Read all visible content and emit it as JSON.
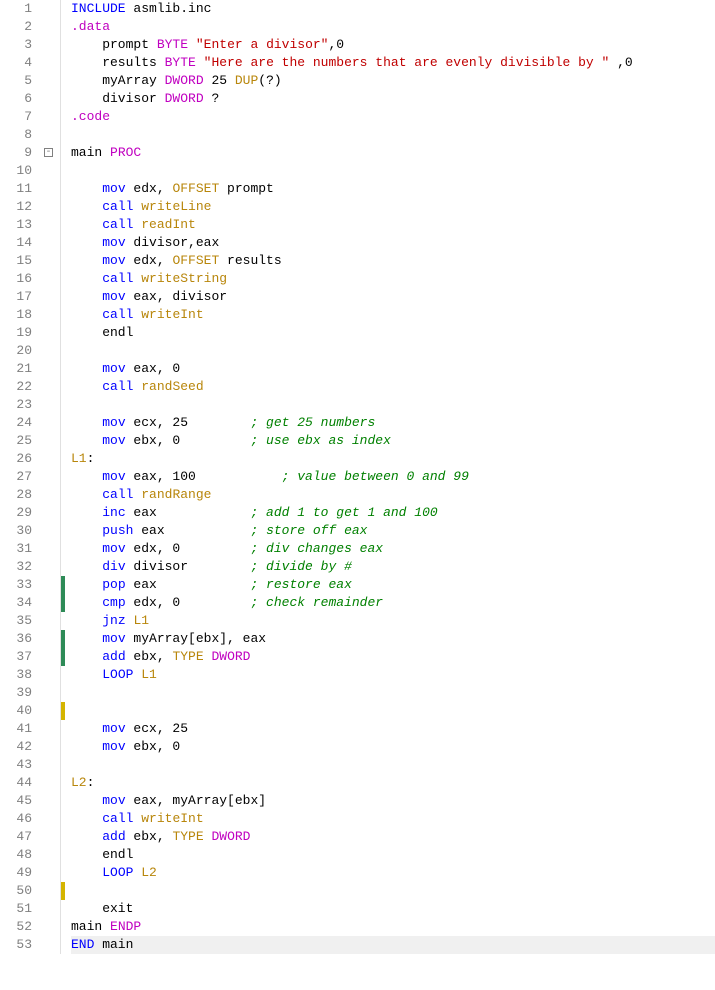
{
  "total_lines": 53,
  "fold_markers": [
    {
      "line": 9,
      "symbol": "-"
    }
  ],
  "change_markers": [
    {
      "line": 33,
      "color": "green"
    },
    {
      "line": 34,
      "color": "green"
    },
    {
      "line": 36,
      "color": "green"
    },
    {
      "line": 37,
      "color": "green"
    },
    {
      "line": 40,
      "color": "yellow"
    },
    {
      "line": 50,
      "color": "yellow"
    }
  ],
  "current_line": 53,
  "lines": [
    {
      "n": 1,
      "t": [
        [
          "kw",
          "INCLUDE"
        ],
        [
          "",
          " asmlib.inc"
        ]
      ]
    },
    {
      "n": 2,
      "t": [
        [
          "dir",
          ".data"
        ]
      ]
    },
    {
      "n": 3,
      "t": [
        [
          "",
          "    prompt "
        ],
        [
          "type",
          "BYTE"
        ],
        [
          "",
          " "
        ],
        [
          "str",
          "\"Enter a divisor\""
        ],
        [
          "",
          ",0"
        ]
      ]
    },
    {
      "n": 4,
      "t": [
        [
          "",
          "    results "
        ],
        [
          "type",
          "BYTE"
        ],
        [
          "",
          " "
        ],
        [
          "str",
          "\"Here are the numbers that are evenly divisible by \""
        ],
        [
          "",
          " ,0"
        ]
      ]
    },
    {
      "n": 5,
      "t": [
        [
          "",
          "    myArray "
        ],
        [
          "type",
          "DWORD"
        ],
        [
          "",
          " 25 "
        ],
        [
          "macro",
          "DUP"
        ],
        [
          "",
          "(?)"
        ]
      ]
    },
    {
      "n": 6,
      "t": [
        [
          "",
          "    divisor "
        ],
        [
          "type",
          "DWORD"
        ],
        [
          "",
          " ?"
        ]
      ]
    },
    {
      "n": 7,
      "t": [
        [
          "dir",
          ".code"
        ]
      ]
    },
    {
      "n": 8,
      "t": [
        [
          "",
          ""
        ]
      ]
    },
    {
      "n": 9,
      "t": [
        [
          "",
          "main "
        ],
        [
          "type",
          "PROC"
        ]
      ]
    },
    {
      "n": 10,
      "t": [
        [
          "",
          ""
        ]
      ]
    },
    {
      "n": 11,
      "t": [
        [
          "",
          "    "
        ],
        [
          "kw",
          "mov"
        ],
        [
          "",
          " edx, "
        ],
        [
          "macro",
          "OFFSET"
        ],
        [
          "",
          " prompt"
        ]
      ]
    },
    {
      "n": 12,
      "t": [
        [
          "",
          "    "
        ],
        [
          "kw",
          "call"
        ],
        [
          "",
          " "
        ],
        [
          "proc",
          "writeLine"
        ]
      ]
    },
    {
      "n": 13,
      "t": [
        [
          "",
          "    "
        ],
        [
          "kw",
          "call"
        ],
        [
          "",
          " "
        ],
        [
          "proc",
          "readInt"
        ]
      ]
    },
    {
      "n": 14,
      "t": [
        [
          "",
          "    "
        ],
        [
          "kw",
          "mov"
        ],
        [
          "",
          " divisor,eax"
        ]
      ]
    },
    {
      "n": 15,
      "t": [
        [
          "",
          "    "
        ],
        [
          "kw",
          "mov"
        ],
        [
          "",
          " edx, "
        ],
        [
          "macro",
          "OFFSET"
        ],
        [
          "",
          " results"
        ]
      ]
    },
    {
      "n": 16,
      "t": [
        [
          "",
          "    "
        ],
        [
          "kw",
          "call"
        ],
        [
          "",
          " "
        ],
        [
          "proc",
          "writeString"
        ]
      ]
    },
    {
      "n": 17,
      "t": [
        [
          "",
          "    "
        ],
        [
          "kw",
          "mov"
        ],
        [
          "",
          " eax, divisor"
        ]
      ]
    },
    {
      "n": 18,
      "t": [
        [
          "",
          "    "
        ],
        [
          "kw",
          "call"
        ],
        [
          "",
          " "
        ],
        [
          "proc",
          "writeInt"
        ]
      ]
    },
    {
      "n": 19,
      "t": [
        [
          "",
          "    endl"
        ]
      ]
    },
    {
      "n": 20,
      "t": [
        [
          "",
          ""
        ]
      ]
    },
    {
      "n": 21,
      "t": [
        [
          "",
          "    "
        ],
        [
          "kw",
          "mov"
        ],
        [
          "",
          " eax, 0"
        ]
      ]
    },
    {
      "n": 22,
      "t": [
        [
          "",
          "    "
        ],
        [
          "kw",
          "call"
        ],
        [
          "",
          " "
        ],
        [
          "proc",
          "randSeed"
        ]
      ]
    },
    {
      "n": 23,
      "t": [
        [
          "",
          ""
        ]
      ]
    },
    {
      "n": 24,
      "t": [
        [
          "",
          "    "
        ],
        [
          "kw",
          "mov"
        ],
        [
          "",
          " ecx, 25        "
        ],
        [
          "comment",
          "; get 25 numbers"
        ]
      ]
    },
    {
      "n": 25,
      "t": [
        [
          "",
          "    "
        ],
        [
          "kw",
          "mov"
        ],
        [
          "",
          " ebx, 0         "
        ],
        [
          "comment",
          "; use ebx as index"
        ]
      ]
    },
    {
      "n": 26,
      "t": [
        [
          "label",
          "L1"
        ],
        [
          "",
          ":"
        ]
      ]
    },
    {
      "n": 27,
      "t": [
        [
          "",
          "    "
        ],
        [
          "kw",
          "mov"
        ],
        [
          "",
          " eax, 100           "
        ],
        [
          "comment",
          "; value between 0 and 99"
        ]
      ]
    },
    {
      "n": 28,
      "t": [
        [
          "",
          "    "
        ],
        [
          "kw",
          "call"
        ],
        [
          "",
          " "
        ],
        [
          "proc",
          "randRange"
        ]
      ]
    },
    {
      "n": 29,
      "t": [
        [
          "",
          "    "
        ],
        [
          "kw",
          "inc"
        ],
        [
          "",
          " eax            "
        ],
        [
          "comment",
          "; add 1 to get 1 and 100"
        ]
      ]
    },
    {
      "n": 30,
      "t": [
        [
          "",
          "    "
        ],
        [
          "kw",
          "push"
        ],
        [
          "",
          " eax           "
        ],
        [
          "comment",
          "; store off eax"
        ]
      ]
    },
    {
      "n": 31,
      "t": [
        [
          "",
          "    "
        ],
        [
          "kw",
          "mov"
        ],
        [
          "",
          " edx, 0         "
        ],
        [
          "comment",
          "; div changes eax"
        ]
      ]
    },
    {
      "n": 32,
      "t": [
        [
          "",
          "    "
        ],
        [
          "kw",
          "div"
        ],
        [
          "",
          " divisor        "
        ],
        [
          "comment",
          "; divide by #"
        ]
      ]
    },
    {
      "n": 33,
      "t": [
        [
          "",
          "    "
        ],
        [
          "kw",
          "pop"
        ],
        [
          "",
          " eax            "
        ],
        [
          "comment",
          "; restore eax"
        ]
      ]
    },
    {
      "n": 34,
      "t": [
        [
          "",
          "    "
        ],
        [
          "kw",
          "cmp"
        ],
        [
          "",
          " edx, 0         "
        ],
        [
          "comment",
          "; check remainder"
        ]
      ]
    },
    {
      "n": 35,
      "t": [
        [
          "",
          "    "
        ],
        [
          "kw",
          "jnz"
        ],
        [
          "",
          " "
        ],
        [
          "label",
          "L1"
        ]
      ]
    },
    {
      "n": 36,
      "t": [
        [
          "",
          "    "
        ],
        [
          "kw",
          "mov"
        ],
        [
          "",
          " myArray[ebx], eax"
        ]
      ]
    },
    {
      "n": 37,
      "t": [
        [
          "",
          "    "
        ],
        [
          "kw",
          "add"
        ],
        [
          "",
          " ebx, "
        ],
        [
          "macro",
          "TYPE"
        ],
        [
          "",
          " "
        ],
        [
          "type",
          "DWORD"
        ]
      ]
    },
    {
      "n": 38,
      "t": [
        [
          "",
          "    "
        ],
        [
          "kw",
          "LOOP"
        ],
        [
          "",
          " "
        ],
        [
          "label",
          "L1"
        ]
      ]
    },
    {
      "n": 39,
      "t": [
        [
          "",
          ""
        ]
      ]
    },
    {
      "n": 40,
      "t": [
        [
          "",
          ""
        ]
      ]
    },
    {
      "n": 41,
      "t": [
        [
          "",
          "    "
        ],
        [
          "kw",
          "mov"
        ],
        [
          "",
          " ecx, 25"
        ]
      ]
    },
    {
      "n": 42,
      "t": [
        [
          "",
          "    "
        ],
        [
          "kw",
          "mov"
        ],
        [
          "",
          " ebx, 0"
        ]
      ]
    },
    {
      "n": 43,
      "t": [
        [
          "",
          ""
        ]
      ]
    },
    {
      "n": 44,
      "t": [
        [
          "label",
          "L2"
        ],
        [
          "",
          ":"
        ]
      ]
    },
    {
      "n": 45,
      "t": [
        [
          "",
          "    "
        ],
        [
          "kw",
          "mov"
        ],
        [
          "",
          " eax, myArray[ebx]"
        ]
      ]
    },
    {
      "n": 46,
      "t": [
        [
          "",
          "    "
        ],
        [
          "kw",
          "call"
        ],
        [
          "",
          " "
        ],
        [
          "proc",
          "writeInt"
        ]
      ]
    },
    {
      "n": 47,
      "t": [
        [
          "",
          "    "
        ],
        [
          "kw",
          "add"
        ],
        [
          "",
          " ebx, "
        ],
        [
          "macro",
          "TYPE"
        ],
        [
          "",
          " "
        ],
        [
          "type",
          "DWORD"
        ]
      ]
    },
    {
      "n": 48,
      "t": [
        [
          "",
          "    endl"
        ]
      ]
    },
    {
      "n": 49,
      "t": [
        [
          "",
          "    "
        ],
        [
          "kw",
          "LOOP"
        ],
        [
          "",
          " "
        ],
        [
          "label",
          "L2"
        ]
      ]
    },
    {
      "n": 50,
      "t": [
        [
          "",
          ""
        ]
      ]
    },
    {
      "n": 51,
      "t": [
        [
          "",
          "    exit"
        ]
      ]
    },
    {
      "n": 52,
      "t": [
        [
          "",
          "main "
        ],
        [
          "type",
          "ENDP"
        ]
      ]
    },
    {
      "n": 53,
      "t": [
        [
          "kw",
          "END"
        ],
        [
          "",
          " main"
        ]
      ]
    }
  ]
}
